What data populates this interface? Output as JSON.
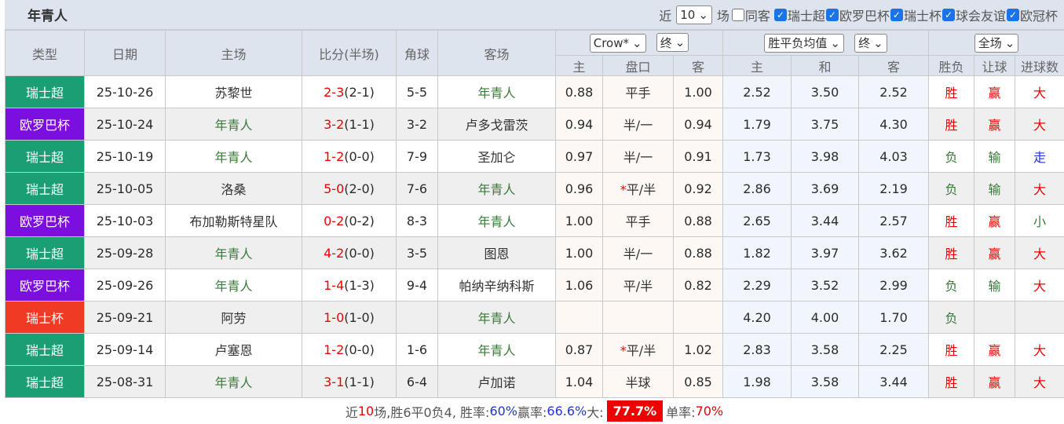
{
  "header": {
    "title": "年青人",
    "recent_label": "近",
    "recent_value": "10",
    "games_label": "场",
    "filters": [
      {
        "label": "同客",
        "checked": false
      },
      {
        "label": "瑞士超",
        "checked": true
      },
      {
        "label": "欧罗巴杯",
        "checked": true
      },
      {
        "label": "瑞士杯",
        "checked": true
      },
      {
        "label": "球会友谊",
        "checked": true
      },
      {
        "label": "欧冠杯",
        "checked": true
      }
    ]
  },
  "columns": {
    "type": "类型",
    "date": "日期",
    "home": "主场",
    "score": "比分(半场)",
    "corner": "角球",
    "away": "客场",
    "asian_company": "Crow*",
    "asian_stage": "终",
    "euro_type": "胜平负均值",
    "euro_stage": "终",
    "scope": "全场",
    "sub": [
      "主",
      "盘口",
      "客",
      "主",
      "和",
      "客",
      "胜负",
      "让球",
      "进球数"
    ]
  },
  "colors": {
    "瑞士超": "#1c9e74",
    "欧罗巴杯": "#7a0fe0",
    "瑞士杯": "#f03a24"
  },
  "rows": [
    {
      "league": "瑞士超",
      "date": "25-10-26",
      "home": "苏黎世",
      "ft": "2-3",
      "ht": "(2-1)",
      "corner": "5-5",
      "away": "年青人",
      "ah": "0.88",
      "line": "平手",
      "aa": "1.00",
      "eh": "2.52",
      "ed": "3.50",
      "ea": "2.52",
      "wl": "胜",
      "hc": "赢",
      "ou": "大",
      "team_home": false
    },
    {
      "league": "欧罗巴杯",
      "date": "25-10-24",
      "home": "年青人",
      "ft": "3-2",
      "ht": "(1-1)",
      "corner": "3-2",
      "away": "卢多戈雷茨",
      "ah": "0.94",
      "line": "半/一",
      "aa": "0.94",
      "eh": "1.79",
      "ed": "3.75",
      "ea": "4.30",
      "wl": "胜",
      "hc": "赢",
      "ou": "大",
      "team_home": true
    },
    {
      "league": "瑞士超",
      "date": "25-10-19",
      "home": "年青人",
      "ft": "1-2",
      "ht": "(0-0)",
      "corner": "7-9",
      "away": "圣加仑",
      "ah": "0.97",
      "line": "半/一",
      "aa": "0.91",
      "eh": "1.73",
      "ed": "3.98",
      "ea": "4.03",
      "wl": "负",
      "hc": "输",
      "ou": "走",
      "team_home": true
    },
    {
      "league": "瑞士超",
      "date": "25-10-05",
      "home": "洛桑",
      "ft": "5-0",
      "ht": "(2-0)",
      "corner": "7-6",
      "away": "年青人",
      "ah": "0.96",
      "line_star": "*",
      "line": "平/半",
      "aa": "0.92",
      "eh": "2.86",
      "ed": "3.69",
      "ea": "2.19",
      "wl": "负",
      "hc": "输",
      "ou": "大",
      "team_home": false
    },
    {
      "league": "欧罗巴杯",
      "date": "25-10-03",
      "home": "布加勒斯特星队",
      "ft": "0-2",
      "ht": "(0-2)",
      "corner": "8-3",
      "away": "年青人",
      "ah": "1.00",
      "line": "平手",
      "aa": "0.88",
      "eh": "2.65",
      "ed": "3.44",
      "ea": "2.57",
      "wl": "胜",
      "hc": "赢",
      "ou": "小",
      "team_home": false
    },
    {
      "league": "瑞士超",
      "date": "25-09-28",
      "home": "年青人",
      "ft": "4-2",
      "ht": "(0-0)",
      "corner": "3-5",
      "away": "图恩",
      "ah": "1.00",
      "line": "半/一",
      "aa": "0.88",
      "eh": "1.82",
      "ed": "3.97",
      "ea": "3.62",
      "wl": "胜",
      "hc": "赢",
      "ou": "大",
      "team_home": true
    },
    {
      "league": "欧罗巴杯",
      "date": "25-09-26",
      "home": "年青人",
      "ft": "1-4",
      "ht": "(1-3)",
      "corner": "9-4",
      "away": "帕纳辛纳科斯",
      "ah": "1.06",
      "line": "平/半",
      "aa": "0.82",
      "eh": "2.29",
      "ed": "3.52",
      "ea": "2.99",
      "wl": "负",
      "hc": "输",
      "ou": "大",
      "team_home": true
    },
    {
      "league": "瑞士杯",
      "date": "25-09-21",
      "home": "阿劳",
      "ft": "1-0",
      "ht": "(1-0)",
      "corner": "",
      "away": "年青人",
      "ah": "",
      "line": "",
      "aa": "",
      "eh": "4.20",
      "ed": "4.00",
      "ea": "1.70",
      "wl": "负",
      "hc": "",
      "ou": "",
      "team_home": false
    },
    {
      "league": "瑞士超",
      "date": "25-09-14",
      "home": "卢塞恩",
      "ft": "1-2",
      "ht": "(0-0)",
      "corner": "1-6",
      "away": "年青人",
      "ah": "0.87",
      "line_star": "*",
      "line": "平/半",
      "aa": "1.02",
      "eh": "2.83",
      "ed": "3.58",
      "ea": "2.25",
      "wl": "胜",
      "hc": "赢",
      "ou": "大",
      "team_home": false
    },
    {
      "league": "瑞士超",
      "date": "25-08-31",
      "home": "年青人",
      "ft": "3-1",
      "ht": "(1-1)",
      "corner": "6-4",
      "away": "卢加诺",
      "ah": "1.04",
      "line": "半球",
      "aa": "0.85",
      "eh": "1.98",
      "ed": "3.58",
      "ea": "3.44",
      "wl": "胜",
      "hc": "赢",
      "ou": "大",
      "team_home": true
    }
  ],
  "footer": {
    "p1": "近",
    "n": "10",
    "p2": "场,胜6平0负4, 胜率:",
    "win_rate": "60%",
    "p3": " 赢率:",
    "cover_rate": "66.6%",
    "p4": " 大:",
    "over_rate": "77.7%",
    "p5": " 单率:",
    "odd_rate": "70%"
  }
}
